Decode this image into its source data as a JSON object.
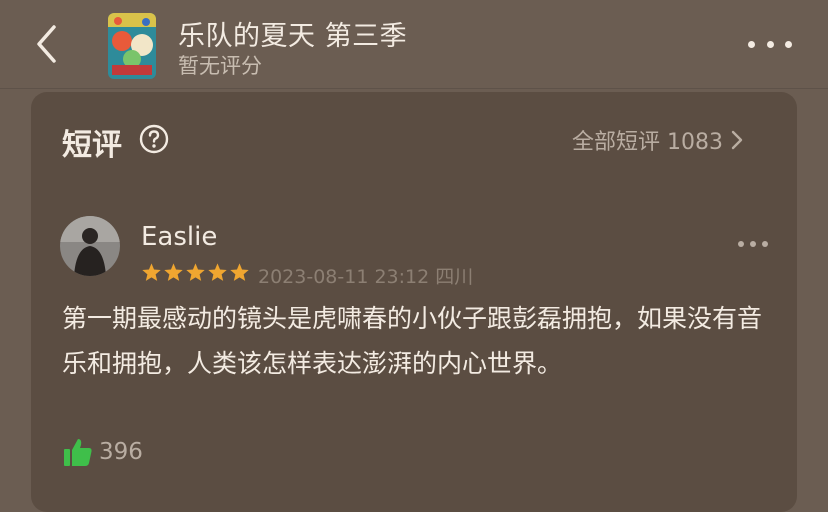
{
  "header": {
    "title": "乐队的夏天 第三季",
    "rating": "暂无评分"
  },
  "section": {
    "title": "短评",
    "all_reviews": "全部短评 1083"
  },
  "review": {
    "username": "Easlie",
    "stars": 5,
    "datetime": "2023-08-11 23:12",
    "location": "四川",
    "text": "第一期最感动的镜头是虎啸春的小伙子跟彭磊拥抱，如果没有音乐和拥抱，人类该怎样表达澎湃的内心世界。",
    "likes": "396"
  },
  "colors": {
    "background": "#6b5d52",
    "card": "#5b4d42",
    "star": "#f0a630",
    "like": "#3fbf4a"
  }
}
